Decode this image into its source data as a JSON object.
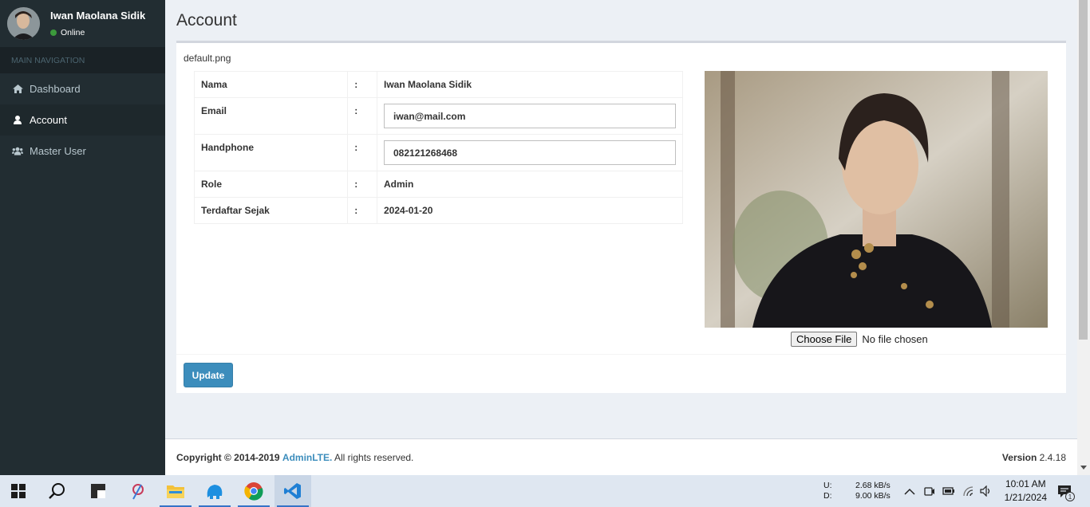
{
  "sidebar": {
    "user_name": "Iwan Maolana Sidik",
    "user_status": "Online",
    "nav_header": "MAIN NAVIGATION",
    "items": [
      {
        "label": "Dashboard",
        "icon": "home-icon"
      },
      {
        "label": "Account",
        "icon": "user-icon"
      },
      {
        "label": "Master User",
        "icon": "users-icon"
      }
    ],
    "active_item": "Account"
  },
  "page": {
    "title": "Account",
    "file_name": "default.png"
  },
  "form": {
    "rows": [
      {
        "label": "Nama",
        "separator": ":",
        "value": "Iwan Maolana Sidik"
      },
      {
        "label": "Email",
        "separator": ":",
        "value": "iwan@mail.com"
      },
      {
        "label": "Handphone",
        "separator": ":",
        "value": "082121268468"
      },
      {
        "label": "Role",
        "separator": ":",
        "value": "Admin"
      },
      {
        "label": "Terdaftar Sejak",
        "separator": ":",
        "value": "2024-01-20"
      }
    ],
    "choose_file_label": "Choose File",
    "no_file_text": "No file chosen",
    "update_label": "Update"
  },
  "footer": {
    "copyright_prefix": "Copyright © 2014-2019",
    "brand": "AdminLTE.",
    "rights": "All rights reserved.",
    "version_label": "Version",
    "version_number": "2.4.18"
  },
  "taskbar": {
    "upload_label": "U:",
    "download_label": "D:",
    "upload_rate": "2.68 kB/s",
    "download_rate": "9.00 kB/s",
    "time": "10:01 AM",
    "date": "1/21/2024",
    "notification_count": "1"
  },
  "colors": {
    "sidebar_bg": "#222d32",
    "accent": "#3c8dbc",
    "status_online": "#3c9a3c"
  }
}
